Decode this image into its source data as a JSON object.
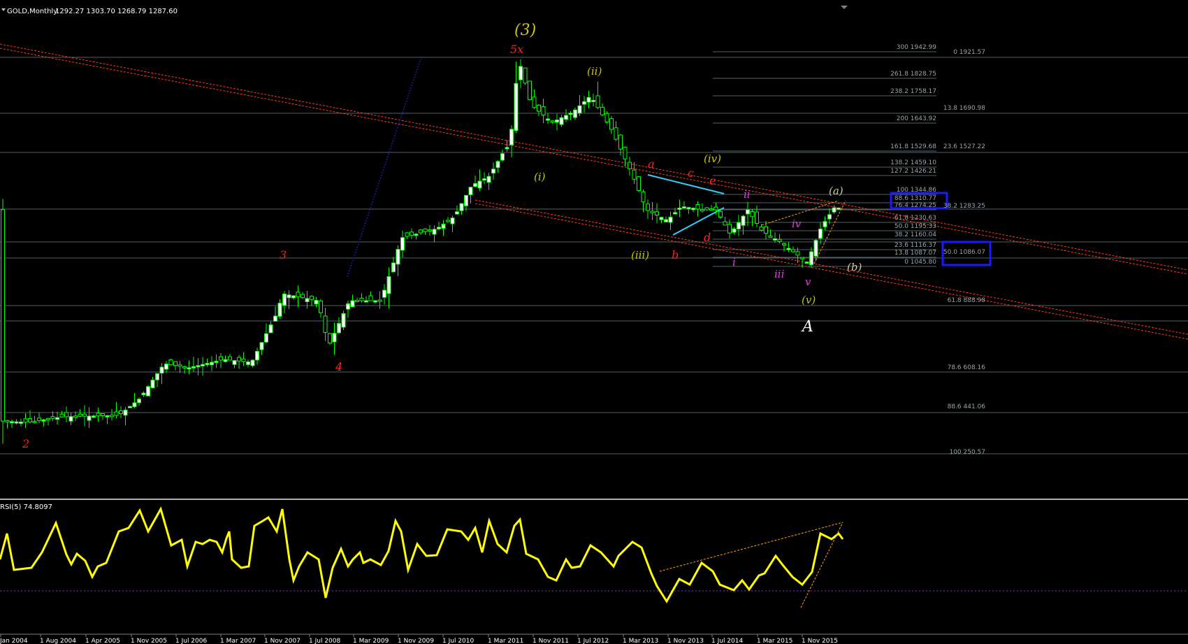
{
  "header": {
    "symbol_label": "GOLD,Monthly",
    "ohlc_label": "1292.27 1303.70 1268.79 1287.60"
  },
  "indicator": {
    "label": "RSI(5) 74.8097"
  },
  "colors": {
    "background": "#000000",
    "up_candle": "#00ff00",
    "up_body": "#ffffff",
    "channel": "#ff3b1a",
    "fib_line": "#6f7f86",
    "fib_text": "#9aa4a8",
    "rsi": "#ffff00",
    "trend": "#ffa500",
    "highlight": "#1a1aff",
    "triangle": "#33ccff"
  },
  "x_axis_labels": [
    "Jan 2004",
    "1 Aug 2004",
    "1 Apr 2005",
    "1 Nov 2005",
    "1 Jul 2006",
    "1 Mar 2007",
    "1 Nov 2007",
    "1 Jul 2008",
    "1 Mar 2009",
    "1 Nov 2009",
    "1 Jul 2010",
    "1 Mar 2011",
    "1 Nov 2011",
    "1 Jul 2012",
    "1 Mar 2013",
    "1 Nov 2013",
    "1 Jul 2014",
    "1 Mar 2015",
    "1 Nov 2015"
  ],
  "fib_levels_left": [
    "300 1942.99",
    "261.8 1828.75",
    "238.2 1758.17",
    "200 1643.92",
    "161.8 1529.68",
    "138.2 1459.10",
    "127.2 1426.21",
    "100 1344.86",
    "88.6 1310.77",
    "76.4 1274.25",
    "61.8 1230.63",
    "50.0 1195.33",
    "38.2 1160.04",
    "23.6 1116.37",
    "13.8 1087.07",
    "0 1045.80"
  ],
  "fib_levels_right": [
    "0 1921.57",
    "13.8 1690.98",
    "23.6 1527.22",
    "38.2 1283.25",
    "50.0 1086.07",
    "61.8 888.98",
    "78.6 608.16",
    "88.6 441.06",
    "100 250.57"
  ],
  "wave_labels": {
    "major_3": "(3)",
    "top_5x": "5x",
    "ii": "(ii)",
    "i": "(i)",
    "iv": "(iv)",
    "iii": "(iii)",
    "v": "(v)",
    "a_paren": "(a)",
    "b_paren": "(b)",
    "big_A": "A",
    "red_a": "a",
    "red_b": "b",
    "red_c": "c",
    "red_d": "d",
    "red_e": "e",
    "red_2": "2",
    "red_3": "3",
    "red_4": "4",
    "m_i": "i",
    "m_ii": "ii",
    "m_iii": "iii",
    "m_iv": "iv",
    "m_v": "v"
  }
}
